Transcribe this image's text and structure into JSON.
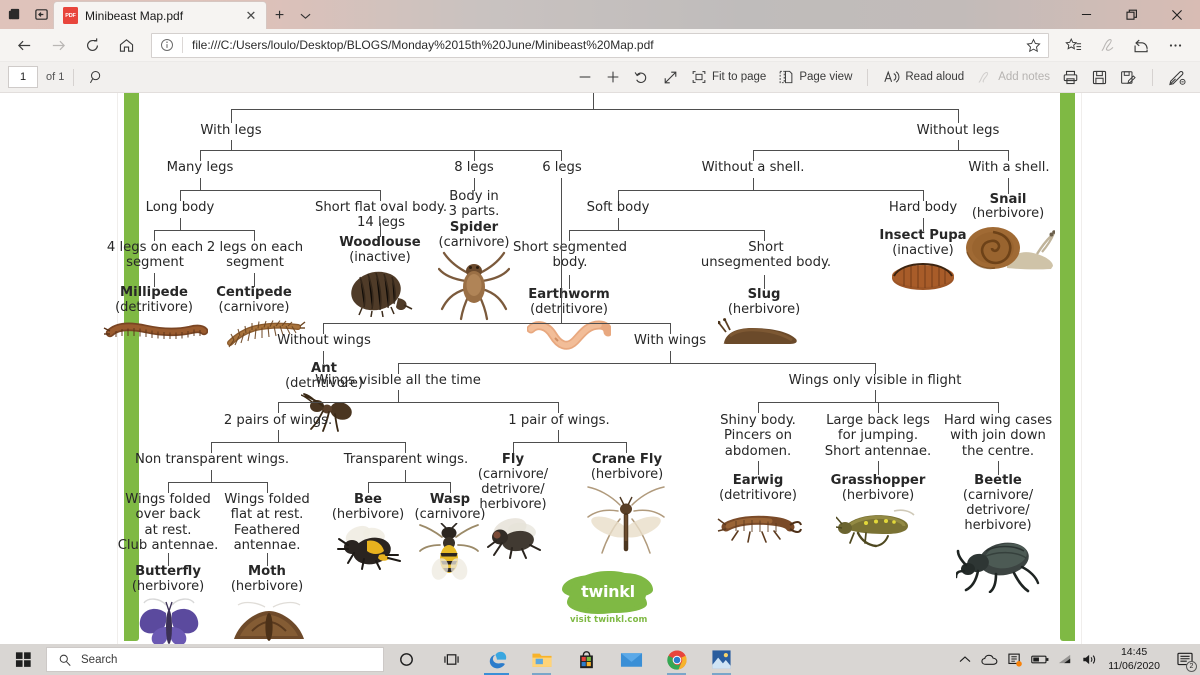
{
  "window": {
    "title": "Minibeast Map.pdf",
    "favicon_label": "PDF",
    "sys_icons": [
      "tab-preview-icon",
      "set-aside-tabs-icon"
    ],
    "new_tab_label": "+",
    "tab_list_chevron": "⌄",
    "controls": {
      "minimize": "—",
      "restore": "restore-icon",
      "close": "✕"
    }
  },
  "navbar": {
    "back": "←",
    "forward": "→",
    "refresh": "↻",
    "home": "home-icon",
    "url": "file:///C:/Users/loulo/Desktop/BLOGS/Monday%2015th%20June/Minibeast%20Map.pdf",
    "info_icon": "info-circle-icon",
    "star_icon": "favorite-star-icon",
    "favorites_icon": "favorites-hub-icon",
    "notes_icon": "web-notes-icon",
    "share_icon": "share-icon",
    "more_icon": "⋯"
  },
  "pdf_toolbar": {
    "page_number": "1",
    "page_count": "of 1",
    "search_icon": "search-icon",
    "zoom_out": "−",
    "zoom_in": "+",
    "rotate_label": "rotate-icon",
    "fit_width_label": "fit-width-icon",
    "fit_to_page": "Fit to page",
    "page_view": "Page view",
    "read_aloud": "Read aloud",
    "add_notes": "Add notes",
    "print_icon": "print-icon",
    "save_icon": "save-icon",
    "save_as_icon": "save-as-icon",
    "draw_icon": "highlighter-icon"
  },
  "document": {
    "accent_green": "#7fb944",
    "line_color": "#4e4e4e",
    "branding": {
      "name": "twinkl",
      "caption": "visit twinkl.com"
    },
    "nodes": {
      "with_legs": "With legs",
      "without_legs": "Without legs",
      "many_legs": "Many legs",
      "eight_legs": "8 legs",
      "six_legs": "6 legs",
      "without_shell": "Without a shell.",
      "with_shell": "With a shell.",
      "long_body": "Long body",
      "short_flat": "Short flat oval body.\n14 legs",
      "body_3_parts": "Body in\n3 parts.",
      "soft_body": "Soft body",
      "hard_body": "Hard body",
      "four_legs_seg": "4 legs on each\nsegment",
      "two_legs_seg": "2 legs on each\nsegment",
      "short_segmented": "Short segmented\nbody.",
      "short_unsegmented": "Short\nunsegmented body.",
      "without_wings": "Without wings",
      "with_wings": "With wings",
      "wings_all_time": "Wings visible all the time",
      "wings_in_flight": "Wings only visible in flight",
      "two_pairs": "2 pairs of wings.",
      "one_pair": "1 pair of wings.",
      "non_transparent": "Non transparent wings.",
      "transparent": "Transparent wings.",
      "wings_over_back": "Wings folded\nover back\nat rest.\nClub antennae.",
      "wings_flat": "Wings folded\nflat at rest.\nFeathered\nantennae.",
      "shiny_body": "Shiny body.\nPincers on\nabdomen.",
      "large_back_legs": "Large back legs\nfor jumping.\nShort antennae.",
      "hard_wing_cases": "Hard wing cases\nwith join down\nthe centre."
    },
    "species": [
      {
        "name": "Millipede",
        "diet": "(detritivore)"
      },
      {
        "name": "Centipede",
        "diet": "(carnivore)"
      },
      {
        "name": "Woodlouse",
        "diet": "(inactive)"
      },
      {
        "name": "Spider",
        "diet": "(carnivore)"
      },
      {
        "name": "Earthworm",
        "diet": "(detritivore)"
      },
      {
        "name": "Slug",
        "diet": "(herbivore)"
      },
      {
        "name": "Insect Pupa",
        "diet": "(inactive)"
      },
      {
        "name": "Snail",
        "diet": "(herbivore)"
      },
      {
        "name": "Ant",
        "diet": "(detritivore)"
      },
      {
        "name": "Butterfly",
        "diet": "(herbivore)"
      },
      {
        "name": "Moth",
        "diet": "(herbivore)"
      },
      {
        "name": "Bee",
        "diet": "(herbivore)"
      },
      {
        "name": "Wasp",
        "diet": "(carnivore)"
      },
      {
        "name": "Fly",
        "diet": "(carnivore/\ndetrivore/\nherbivore)"
      },
      {
        "name": "Crane Fly",
        "diet": "(herbivore)"
      },
      {
        "name": "Earwig",
        "diet": "(detritivore)"
      },
      {
        "name": "Grasshopper",
        "diet": "(herbivore)"
      },
      {
        "name": "Beetle",
        "diet": "(carnivore/\ndetrivore/\nherbivore)"
      }
    ]
  },
  "taskbar": {
    "start_icon": "windows-start-icon",
    "search_placeholder": "Search",
    "cortana_icon": "cortana-icon",
    "taskview_icon": "task-view-icon",
    "pinned": [
      "edge-icon",
      "file-explorer-icon",
      "microsoft-store-icon",
      "mail-icon",
      "chrome-icon",
      "photos-icon"
    ],
    "tray": [
      "show-hidden-icons-icon",
      "onedrive-icon",
      "app-tray-icon",
      "battery-icon",
      "wifi-icon",
      "volume-icon"
    ],
    "time": "14:45",
    "date": "11/06/2020",
    "notifications_icon": "action-center-icon",
    "notifications_count": "2"
  }
}
